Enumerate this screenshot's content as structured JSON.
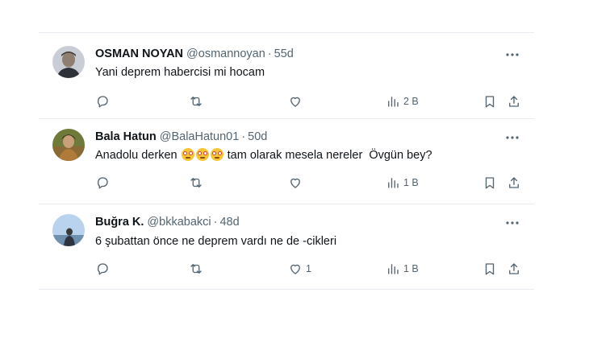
{
  "tweets": [
    {
      "name": "OSMAN NOYAN",
      "handle": "@osmannoyan",
      "separator": "·",
      "time": "55d",
      "text": "Yani deprem habercisi mi hocam",
      "emoji_count": 0,
      "replies": "",
      "retweets": "",
      "likes": "",
      "views": "2 B",
      "avatar_color": "#c9ced6"
    },
    {
      "name": "Bala Hatun",
      "handle": "@BalaHatun01",
      "separator": "·",
      "time": "50d",
      "text_before": "Anadolu derken",
      "emoji_name": "flushed-face",
      "emoji_count": 3,
      "text_after": "tam olarak mesela nereler  Övgün bey?",
      "replies": "",
      "retweets": "",
      "likes": "",
      "views": "1 B",
      "avatar_color": "#7a5a2c"
    },
    {
      "name": "Buğra K.",
      "handle": "@bkkabakci",
      "separator": "·",
      "time": "48d",
      "text": "6 şubattan önce ne deprem vardı ne de -cikleri",
      "emoji_count": 0,
      "replies": "",
      "retweets": "",
      "likes": "1",
      "views": "1 B",
      "avatar_color": "#aac6e6"
    }
  ],
  "icons": {
    "reply": "reply-icon",
    "retweet": "retweet-icon",
    "like": "heart-icon",
    "views": "views-chart-icon",
    "bookmark": "bookmark-icon",
    "share": "share-icon",
    "more": "more-dots-icon"
  },
  "colors": {
    "text": "#0f1419",
    "secondary": "#536471",
    "border": "#e6ecf0"
  }
}
